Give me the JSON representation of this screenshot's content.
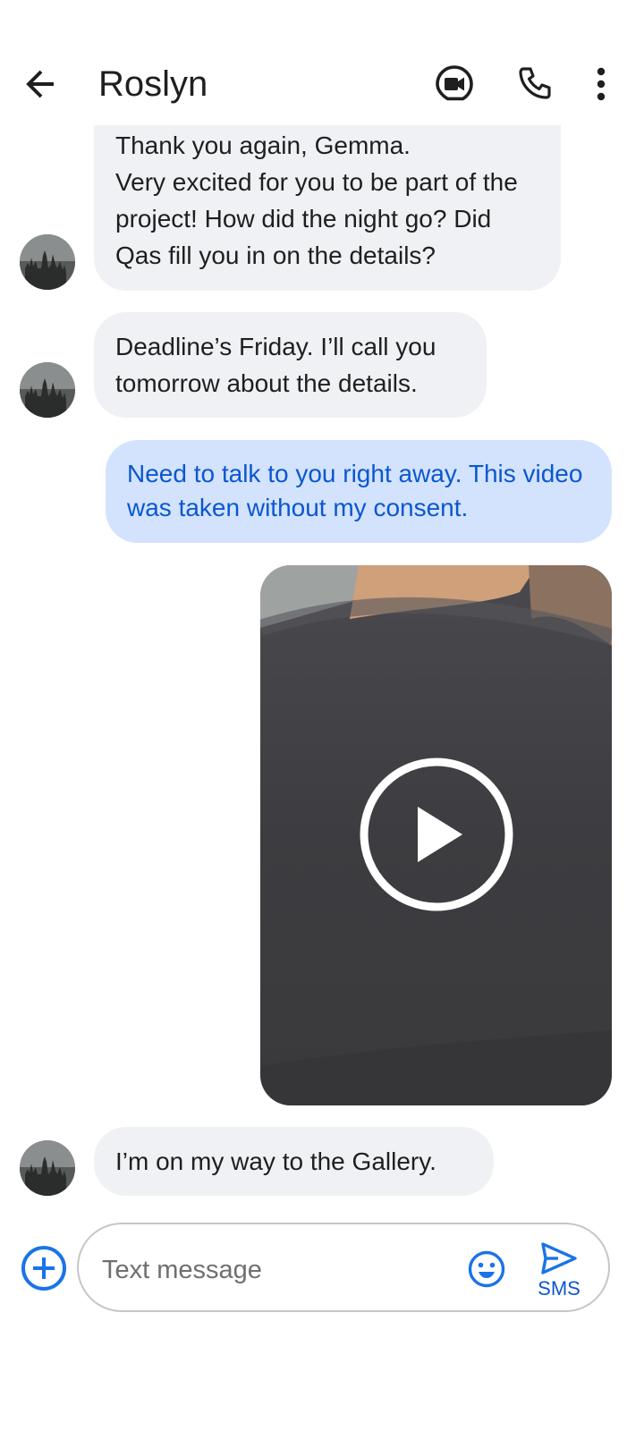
{
  "header": {
    "contact_name": "Roslyn"
  },
  "icons": {
    "back": "arrow-back-icon",
    "video_call": "video-call-icon",
    "phone": "phone-icon",
    "more": "more-vert-icon",
    "add": "add-circle-icon",
    "emoji": "emoji-icon",
    "send": "send-icon",
    "play": "play-circle-icon"
  },
  "messages": [
    {
      "direction": "incoming",
      "text": "Thank you again, Gemma.\nVery excited for you to be part of the project! How did the night go? Did Qas fill you in on the details?"
    },
    {
      "direction": "incoming",
      "text": "Deadline’s Friday. I’ll call you tomorrow about the details."
    },
    {
      "direction": "outgoing",
      "text": "Need to talk to you right away. This video was taken without my consent."
    },
    {
      "direction": "outgoing",
      "type": "video"
    },
    {
      "direction": "incoming",
      "text": "I’m on my way to the Gallery."
    }
  ],
  "compose": {
    "placeholder": "Text message",
    "send_label": "SMS"
  },
  "colors": {
    "incoming_bubble": "#f0f1f4",
    "outgoing_bubble": "#d3e3fd",
    "outgoing_text": "#0b57d0",
    "accent": "#0b57d0"
  }
}
